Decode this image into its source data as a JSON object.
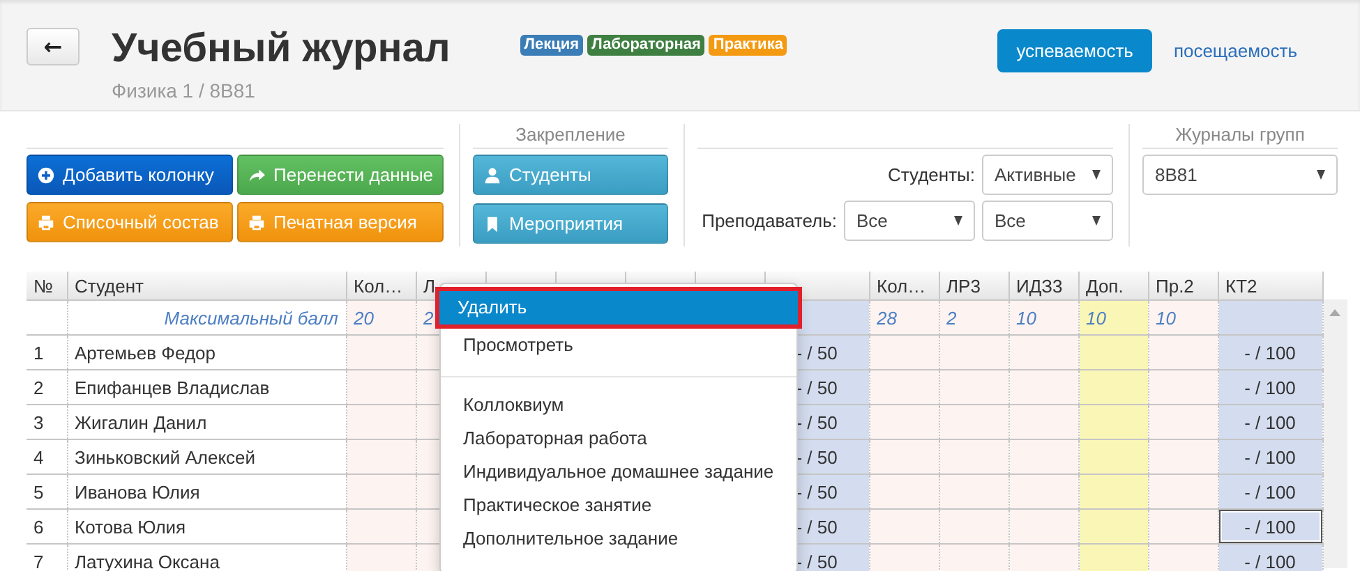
{
  "header": {
    "back_button": "←",
    "title": "Учебный журнал",
    "subtitle": "Физика 1 / 8В81",
    "legend": [
      {
        "label": "Лекция",
        "color": "#3b7db6"
      },
      {
        "label": "Лабораторная",
        "color": "#3f8042"
      },
      {
        "label": "Практика",
        "color": "#f39a12"
      }
    ],
    "nav": [
      {
        "label": "успеваемость",
        "selected": true
      },
      {
        "label": "посещаемость",
        "selected": false
      }
    ]
  },
  "toolbar": {
    "actions": [
      {
        "label": "Добавить колонку",
        "kind": "primary"
      },
      {
        "label": "Перенести данные",
        "kind": "success"
      },
      {
        "label": "Списочный состав",
        "kind": "warning"
      },
      {
        "label": "Печатная версия",
        "kind": "warning"
      }
    ],
    "pin": {
      "title": "Закрепление",
      "buttons": [
        {
          "label": "Студенты"
        },
        {
          "label": "Мероприятия"
        }
      ]
    },
    "filters": [
      {
        "label": "Студенты:",
        "selects": [
          "Активные"
        ]
      },
      {
        "label": "Преподаватель:",
        "selects": [
          "Все",
          "Все"
        ]
      }
    ],
    "groups": {
      "title": "Журналы групп",
      "value": "8В81"
    }
  },
  "table": {
    "columns": [
      {
        "label": "№",
        "kind": "number"
      },
      {
        "label": "Студент",
        "kind": "name"
      },
      {
        "label": "Кол…",
        "kind": "score",
        "max": "20"
      },
      {
        "label": "Л",
        "kind": "score",
        "max": "2"
      },
      {
        "kind": "score"
      },
      {
        "kind": "score"
      },
      {
        "kind": "score"
      },
      {
        "kind": "score"
      },
      {
        "kind": "control"
      },
      {
        "label": "Кол…",
        "kind": "score",
        "max": "28"
      },
      {
        "label": "ЛР3",
        "kind": "score",
        "max": "2"
      },
      {
        "label": "ИДЗ3",
        "kind": "score",
        "max": "10"
      },
      {
        "label": "Доп.",
        "kind": "extra",
        "max": "10"
      },
      {
        "label": "Пр.2",
        "kind": "score",
        "max": "10"
      },
      {
        "label": "КТ2",
        "kind": "control"
      }
    ],
    "max_row": {
      "label": "Максимальный балл"
    },
    "rows": [
      {
        "number": "1",
        "name": "Артемьев Федор",
        "kt1": "- / 50",
        "kt2": "- / 100",
        "kt2_selected": false
      },
      {
        "number": "2",
        "name": "Епифанцев Владислав",
        "kt1": "- / 50",
        "kt2": "- / 100",
        "kt2_selected": false
      },
      {
        "number": "3",
        "name": "Жигалин Данил",
        "kt1": "- / 50",
        "kt2": "- / 100",
        "kt2_selected": false
      },
      {
        "number": "4",
        "name": "Зиньковский Алексей",
        "kt1": "- / 50",
        "kt2": "- / 100",
        "kt2_selected": false
      },
      {
        "number": "5",
        "name": "Иванова Юлия",
        "kt1": "- / 50",
        "kt2": "- / 100",
        "kt2_selected": false
      },
      {
        "number": "6",
        "name": "Котова Юлия",
        "kt1": "- / 50",
        "kt2": "- / 100",
        "kt2_selected": true
      },
      {
        "number": "7",
        "name": "Латухина Оксана",
        "kt1": "- / 50",
        "kt2": "- / 100",
        "kt2_selected": false
      }
    ]
  },
  "context_menu": {
    "items": [
      {
        "label": "Удалить",
        "kind": "item",
        "selected": true,
        "highlighted": true
      },
      {
        "label": "Просмотреть",
        "kind": "item",
        "selected": false,
        "highlighted": false
      },
      {
        "kind": "divider"
      },
      {
        "label": "Коллоквиум",
        "kind": "item",
        "selected": false,
        "highlighted": false
      },
      {
        "label": "Лабораторная работа",
        "kind": "item",
        "selected": false,
        "highlighted": false
      },
      {
        "label": "Индивидуальное домашнее задание",
        "kind": "item",
        "selected": false,
        "highlighted": false
      },
      {
        "label": "Практическое занятие",
        "kind": "item",
        "selected": false,
        "highlighted": false
      },
      {
        "label": "Дополнительное задание",
        "kind": "item",
        "selected": false,
        "highlighted": false
      }
    ]
  }
}
